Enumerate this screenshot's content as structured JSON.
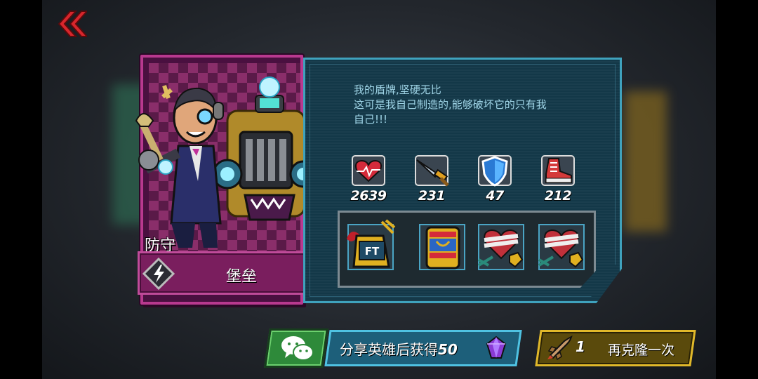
{
  "hero": {
    "role": "防守",
    "name": "堡垒",
    "class_icon": "lightning-icon"
  },
  "quote": {
    "lines": [
      "我的盾牌,坚硬无比",
      "这可是我自己制造的,能够破坏它的只有我",
      "自己!!!"
    ]
  },
  "stats": [
    {
      "icon": "heart-health-icon",
      "value": "2639"
    },
    {
      "icon": "sword-attack-icon",
      "value": "231"
    },
    {
      "icon": "shield-defense-icon",
      "value": "47"
    },
    {
      "icon": "sneaker-speed-icon",
      "value": "212"
    }
  ],
  "equipment": [
    {
      "icon": "ft-box-icon"
    },
    {
      "icon": "striped-shield-icon"
    },
    {
      "icon": "bandaged-heart-icon"
    },
    {
      "icon": "bandaged-heart-icon"
    }
  ],
  "share": {
    "label": "分享英雄后获得",
    "amount": "50",
    "reward_icon": "purple-gem-icon"
  },
  "clone": {
    "count": "1",
    "label": "再克隆一次"
  },
  "colors": {
    "card_frame": "#b8398f",
    "panel_border": "#3fa2bd",
    "quote_text": "#9fd4e6",
    "share_border": "#4fc2e2",
    "clone_border": "#e0b82a",
    "wechat_green": "#2e8a3a"
  }
}
